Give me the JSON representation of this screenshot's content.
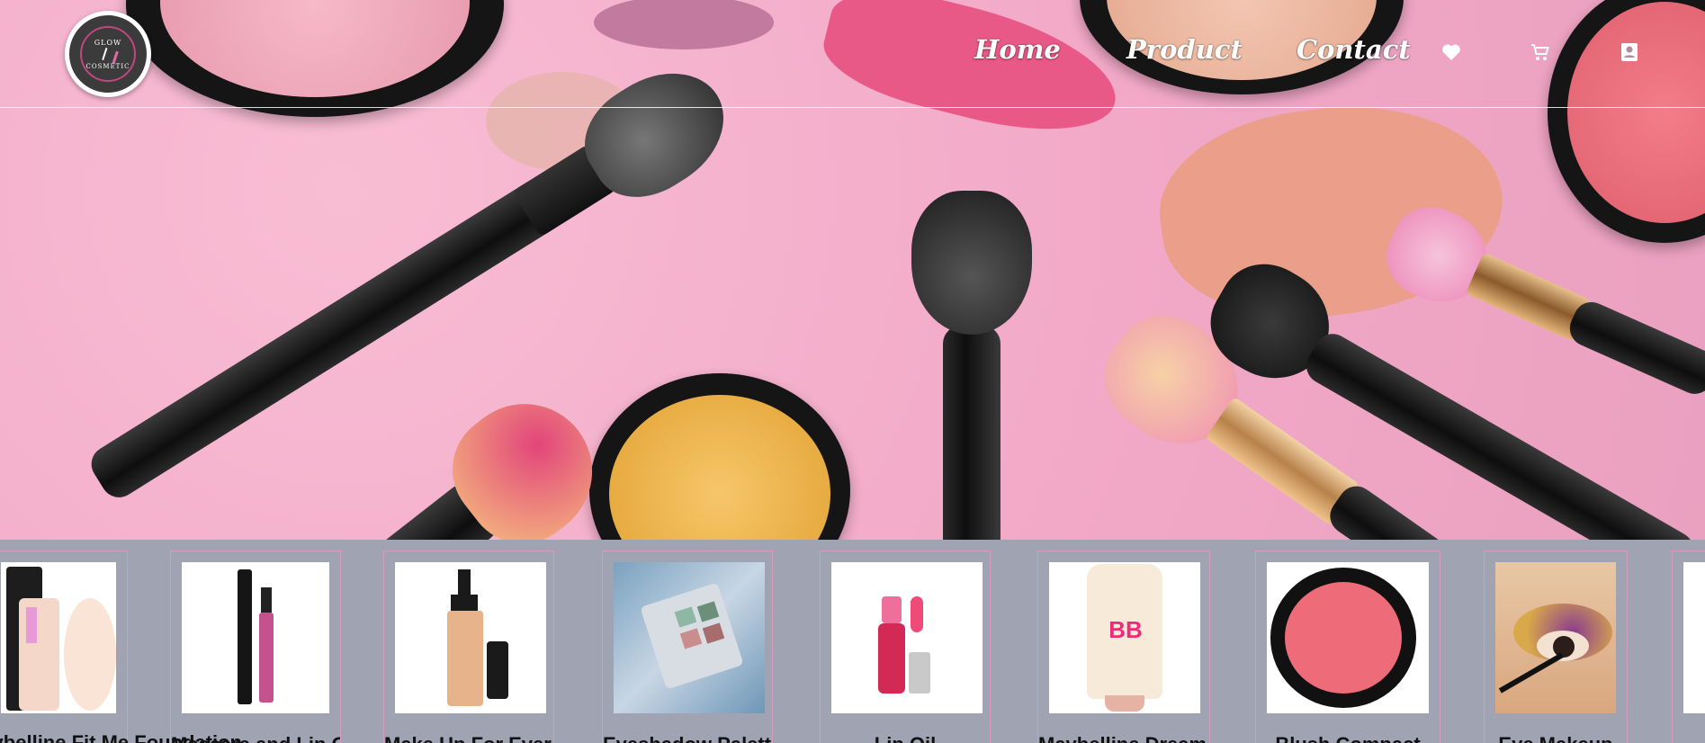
{
  "header": {
    "logo_text_top": "GLOW",
    "logo_text_bottom": "COSMETIC",
    "nav": [
      {
        "label": "Home"
      },
      {
        "label": "Product"
      },
      {
        "label": "Contact"
      }
    ],
    "icons": [
      "heart-icon",
      "cart-icon",
      "user-icon"
    ]
  },
  "colors": {
    "hero_pink": "#f2a9c7",
    "strip_gray": "#a0a4b2",
    "card_border": "#d89bbd"
  },
  "products": [
    {
      "name": "Maybelline Fit Me Foundation",
      "image": "foundation-tube"
    },
    {
      "name": "Mascara and Lip Gloss",
      "image": "mascara-lipgloss"
    },
    {
      "name": "Make Up For Ever Foundation",
      "image": "foundation-bottle"
    },
    {
      "name": "Eyeshadow Palette",
      "image": "eyeshadow-palette"
    },
    {
      "name": "Lip Oil",
      "image": "lip-oil"
    },
    {
      "name": "Maybelline Dream BB Fresh",
      "image": "bb-cream"
    },
    {
      "name": "Blush Compact",
      "image": "blush-compact"
    },
    {
      "name": "Eye Makeup",
      "image": "eye-makeup"
    }
  ]
}
